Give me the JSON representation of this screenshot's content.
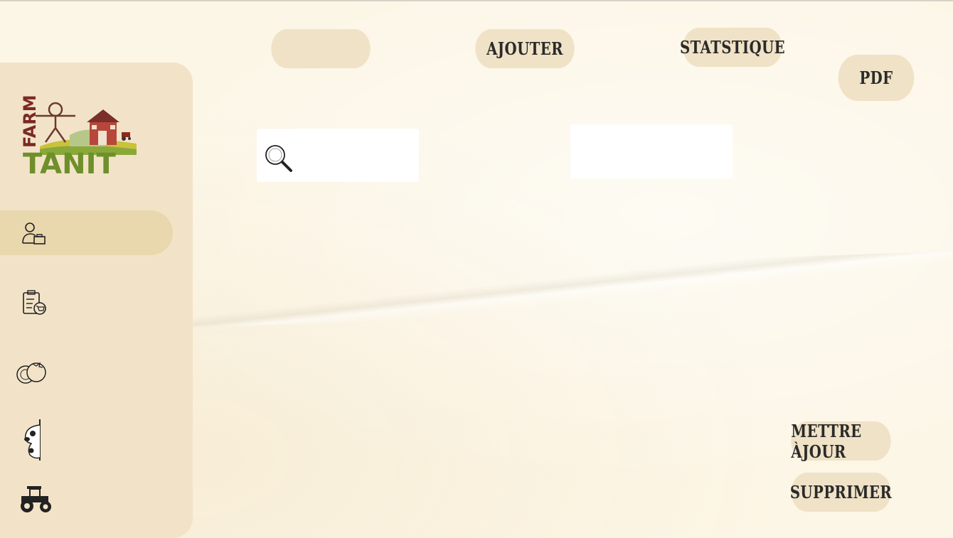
{
  "brand": {
    "word_vertical": "FARM",
    "word_main": "TANIT"
  },
  "toolbar": {
    "blank_button_label": "",
    "add_label": "AJOUTER",
    "stats_label": "STATSTIQUE",
    "pdf_label": "PDF"
  },
  "search": {
    "value": "",
    "placeholder": ""
  },
  "filter_field": {
    "value": ""
  },
  "actions": {
    "update_label": "METTRE ÀJOUR",
    "delete_label": "SUPPRIMER"
  },
  "sidebar": {
    "items": [
      {
        "icon": "employee-icon",
        "active": true
      },
      {
        "icon": "orders-clipboard-icon",
        "active": false
      },
      {
        "icon": "vegetables-icon",
        "active": false
      },
      {
        "icon": "cow-icon",
        "active": false
      },
      {
        "icon": "tractor-icon",
        "active": false
      }
    ]
  },
  "colors": {
    "background": "#fcf6e6",
    "sidebar": "#f2e3c8",
    "active_item": "#e9d7ad",
    "button": "#f0e2c6",
    "logo_green": "#6e8f2a",
    "logo_red": "#7a2a22"
  }
}
